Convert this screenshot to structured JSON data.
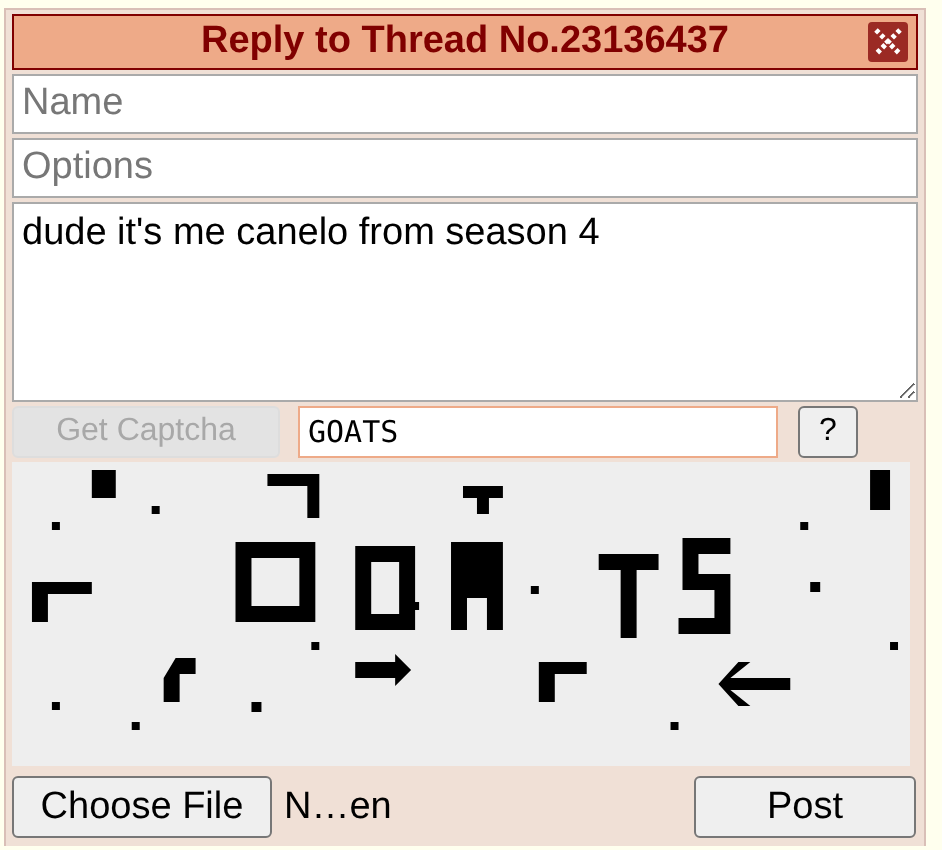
{
  "window": {
    "title": "Reply to Thread No.23136437"
  },
  "fields": [
    {
      "placeholder": "Name"
    },
    {
      "placeholder": "Options"
    }
  ],
  "comment": {
    "value": "dude it's me canelo from season 4"
  },
  "captcha": {
    "button": {
      "label": "Get Captcha",
      "disabled": true
    },
    "answer": {
      "value": "GOATS"
    },
    "help": "?"
  },
  "file": {
    "button": "Choose File",
    "filename": "N…en"
  },
  "post_button": "Post"
}
